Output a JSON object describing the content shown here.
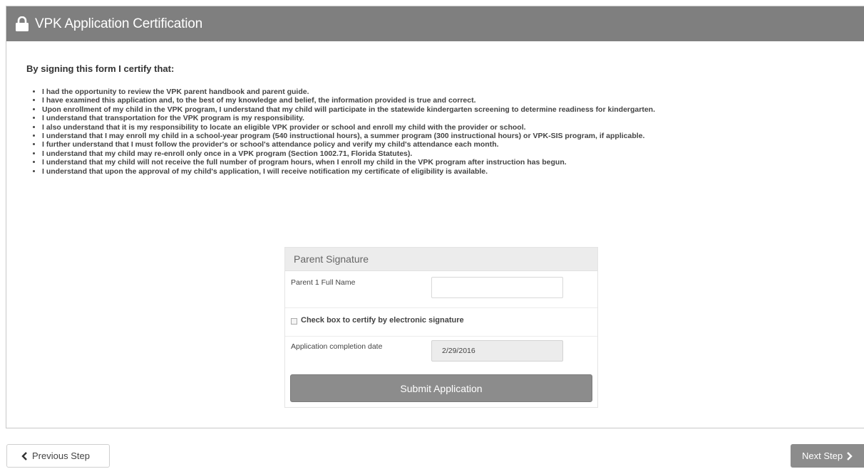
{
  "header": {
    "title": "VPK Application Certification",
    "icon": "lock-icon"
  },
  "certification": {
    "intro": "By signing this form I certify that:",
    "items": [
      "I had the opportunity to review the VPK parent handbook and parent guide.",
      "I have examined this application and, to the best of my knowledge and belief, the information provided is true and correct.",
      "Upon enrollment of my child in the VPK program, I understand that my child will participate in the statewide kindergarten screening to determine readiness for kindergarten.",
      "I understand that transportation for the VPK program is my responsibility.",
      "I also understand that it is my responsibility to locate an eligible VPK provider or school and enroll my child with the provider or school.",
      "I understand that I may enroll my child in a school-year program (540 instructional hours), a summer program (300 instructional hours) or VPK-SIS program, if applicable.",
      "I further understand that I must follow the provider's or school's attendance policy and verify my child's attendance each month.",
      "I understand that my child may re-enroll only once in a VPK program (Section 1002.71, Florida Statutes).",
      "I understand that my child will not receive the full number of program hours, when I enroll my child in the VPK program after instruction has begun.",
      "I understand that upon the approval of my child's application, I will receive notification my certificate of eligibility is available."
    ]
  },
  "signature": {
    "heading": "Parent Signature",
    "parent_name_label": "Parent 1 Full Name",
    "parent_name_value": "",
    "checkbox_label": "Check box to certify by electronic signature",
    "checkbox_checked": false,
    "date_label": "Application completion date",
    "date_value": "2/29/2016",
    "submit_label": "Submit Application"
  },
  "navigation": {
    "previous_label": "Previous Step",
    "next_label": "Next Step"
  },
  "colors": {
    "header_bg": "#7f7f7f",
    "button_bg": "#8c8c8c",
    "card_head_bg": "#ececec"
  }
}
